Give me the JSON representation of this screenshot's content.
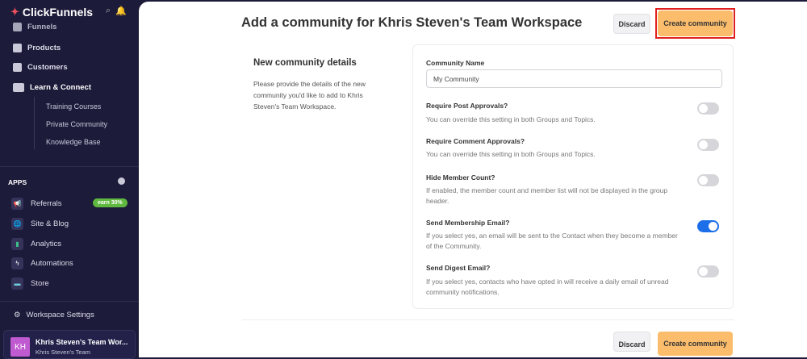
{
  "sidebar": {
    "brand": "ClickFunnels",
    "nav": [
      {
        "label": "Funnels"
      },
      {
        "label": "Products"
      },
      {
        "label": "Customers"
      },
      {
        "label": "Learn & Connect"
      }
    ],
    "sub": [
      {
        "label": "Training Courses"
      },
      {
        "label": "Private Community"
      },
      {
        "label": "Knowledge Base"
      }
    ],
    "apps_label": "APPS",
    "apps": [
      {
        "label": "Referrals",
        "badge": "earn 30%"
      },
      {
        "label": "Site & Blog"
      },
      {
        "label": "Analytics"
      },
      {
        "label": "Automations"
      },
      {
        "label": "Store"
      }
    ],
    "workspace_settings": "Workspace Settings",
    "team": {
      "initials": "KH",
      "name": "Khris Steven's Team Wor...",
      "sub": "Khris Steven's Team"
    }
  },
  "header": {
    "title": "Add a community for Khris Steven's Team Workspace",
    "discard": "Discard",
    "create": "Create community"
  },
  "section": {
    "title": "New community details",
    "desc": "Please provide the details of the new community you'd like to add to Khris Steven's Team Workspace."
  },
  "form": {
    "name_label": "Community Name",
    "name_value": "My Community",
    "settings": [
      {
        "label": "Require Post Approvals?",
        "desc": "You can override this setting in both Groups and Topics.",
        "on": false
      },
      {
        "label": "Require Comment Approvals?",
        "desc": "You can override this setting in both Groups and Topics.",
        "on": false
      },
      {
        "label": "Hide Member Count?",
        "desc": "If enabled, the member count and member list will not be displayed in the group header.",
        "on": false
      },
      {
        "label": "Send Membership Email?",
        "desc": "If you select yes, an email will be sent to the Contact when they become a member of the Community.",
        "on": true
      },
      {
        "label": "Send Digest Email?",
        "desc": "If you select yes, contacts who have opted in will receive a daily email of unread community notifications.",
        "on": false
      }
    ]
  },
  "footer": {
    "discard": "Discard",
    "create": "Create community"
  }
}
